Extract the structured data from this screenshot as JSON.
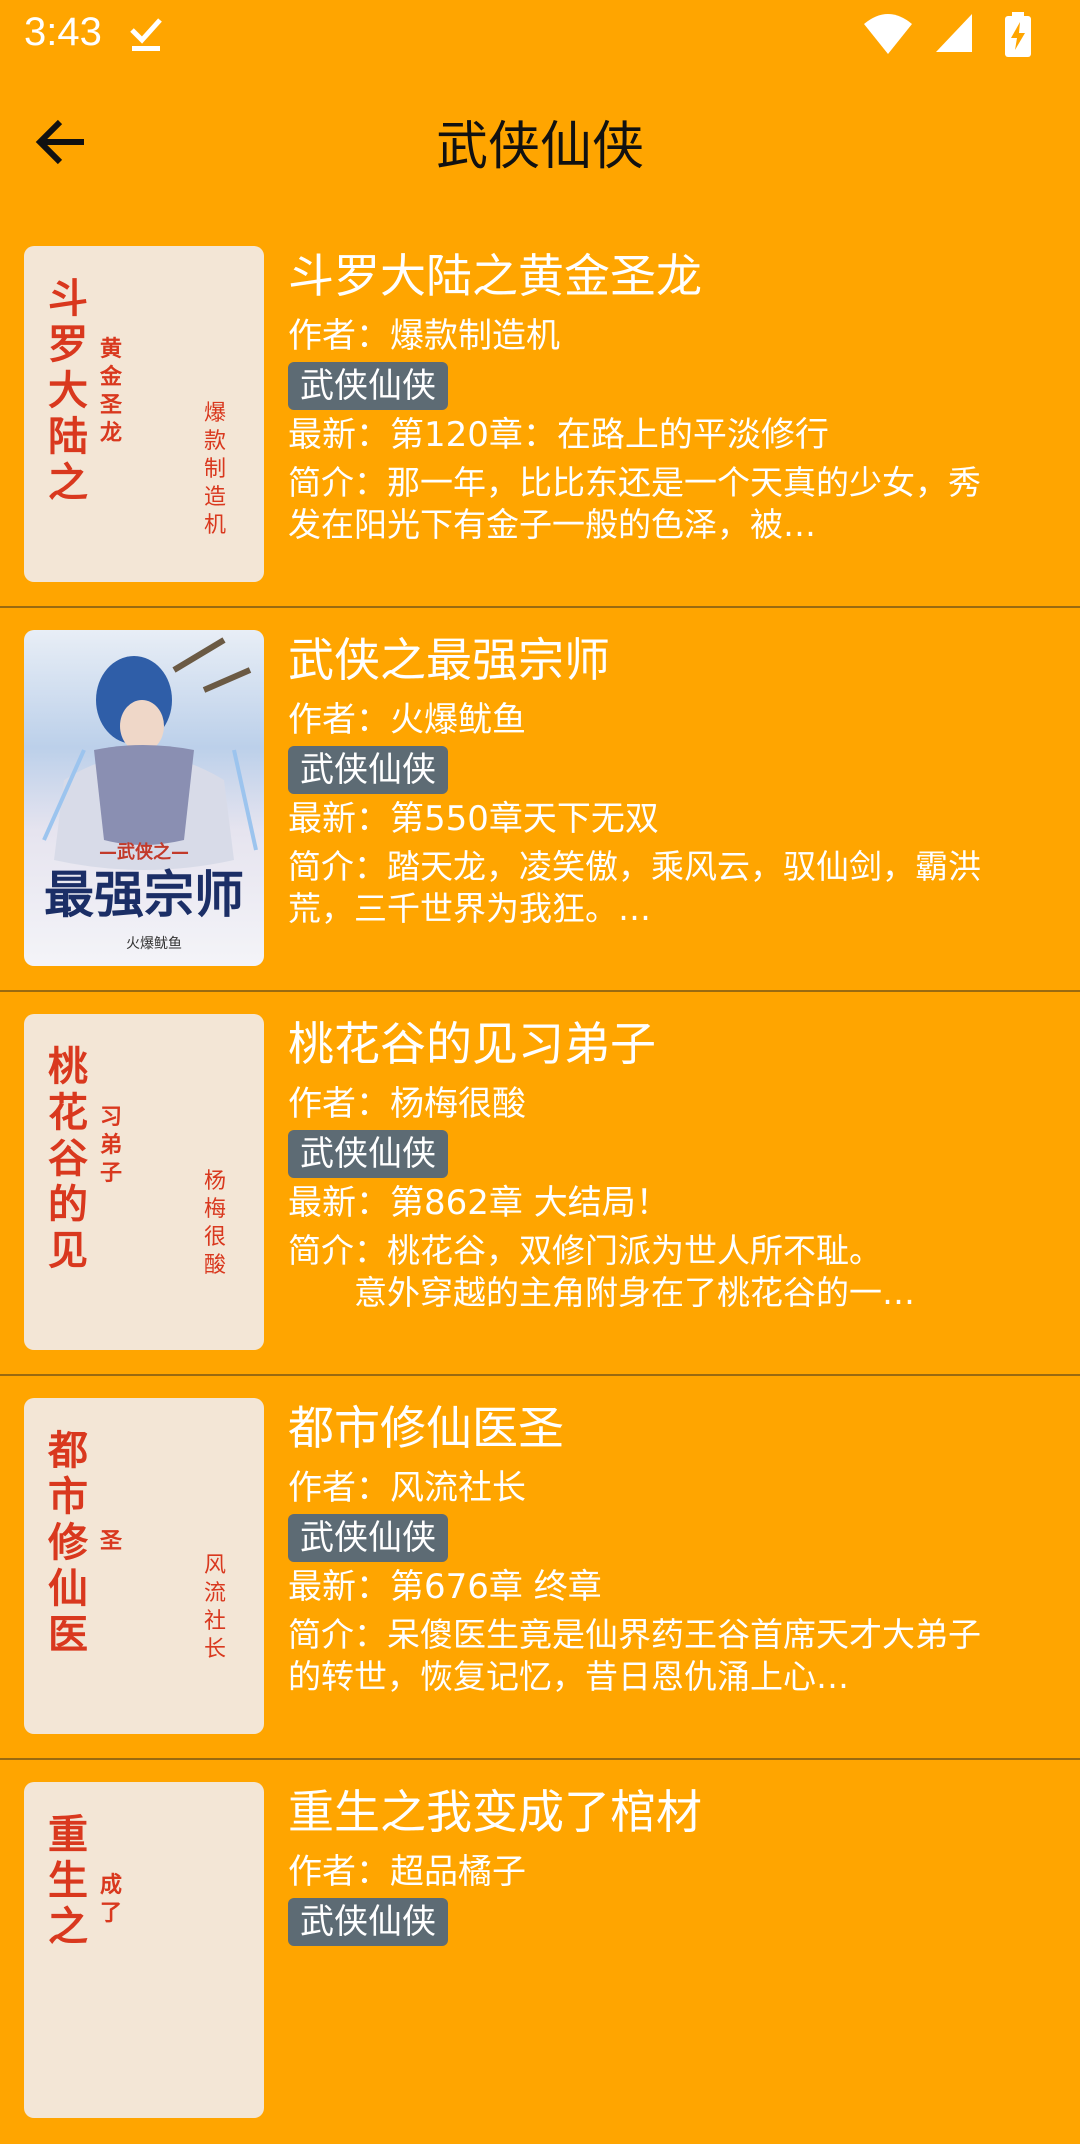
{
  "status_bar": {
    "time": "3:43",
    "icons": [
      "download-done-icon",
      "wifi-icon",
      "signal-icon",
      "battery-charging-icon"
    ]
  },
  "app_bar": {
    "back_icon": "arrow-left-icon",
    "title": "武侠仙侠"
  },
  "colors": {
    "background": "#FFA500",
    "tag_background": "#5d6b74",
    "cover_text": "#d9381e"
  },
  "books": [
    {
      "cover": {
        "main": "斗罗大陆之",
        "sub": "黄金圣龙",
        "author": "爆款制造机"
      },
      "title": "斗罗大陆之黄金圣龙",
      "author": "作者：爆款制造机",
      "tag": "武侠仙侠",
      "latest": "最新：第120章：在路上的平淡修行",
      "intro": "简介：那一年，比比东还是一个天真的少女，秀发在阳光下有金子一般的色泽，被…"
    },
    {
      "cover": {
        "art_title": "最强宗师",
        "art_top": "—武侠之—",
        "art_author": "火爆鱿鱼"
      },
      "title": "武侠之最强宗师",
      "author": "作者：火爆鱿鱼",
      "tag": "武侠仙侠",
      "latest": "最新：第550章天下无双",
      "intro": "简介：踏天龙，凌笑傲，乘风云，驭仙剑，霸洪荒，三千世界为我狂。…"
    },
    {
      "cover": {
        "main": "桃花谷的见",
        "sub": "习弟子",
        "author": "杨梅很酸"
      },
      "title": "桃花谷的见习弟子",
      "author": "作者：杨梅很酸",
      "tag": "武侠仙侠",
      "latest": "最新：第862章 大结局！",
      "intro": "简介：桃花谷，双修门派为世人所不耻。\n　　意外穿越的主角附身在了桃花谷的一…"
    },
    {
      "cover": {
        "main": "都市修仙医",
        "sub": "圣",
        "author": "风流社长"
      },
      "title": "都市修仙医圣",
      "author": "作者：风流社长",
      "tag": "武侠仙侠",
      "latest": "最新：第676章  终章",
      "intro": "简介：呆傻医生竟是仙界药王谷首席天才大弟子的转世，恢复记忆，昔日恩仇涌上心…"
    },
    {
      "cover": {
        "main": "重生之",
        "sub": "成了",
        "author": ""
      },
      "title": "重生之我变成了棺材",
      "author": "作者：超品橘子",
      "tag": "武侠仙侠",
      "latest": "",
      "intro": ""
    }
  ]
}
